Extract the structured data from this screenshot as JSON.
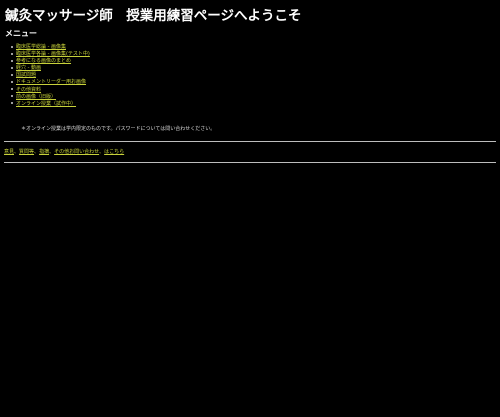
{
  "page": {
    "title": "鍼灸マッサージ師　授業用練習ページへようこそ"
  },
  "menu": {
    "heading": "メニュー",
    "items": [
      {
        "label": "臨床医学総論 - 画像集"
      },
      {
        "label": "臨床医学各論 - 画像集(テスト中)"
      },
      {
        "label": "参考になる画像のまとめ"
      },
      {
        "label": "経穴 - 動画"
      },
      {
        "label": "国試問題"
      },
      {
        "label": "ドキュメントリーダー用お画像"
      },
      {
        "label": "その他資料"
      },
      {
        "label": "前の画像（旧版）"
      },
      {
        "label": "オンライン授業（試作中）"
      }
    ]
  },
  "notice": "＊オンライン授業は学内限定のものです。パスワードについては問い合わせください。",
  "footer": {
    "links": [
      {
        "label": "意見"
      },
      {
        "label": "質問等"
      },
      {
        "label": "指摘"
      },
      {
        "label": "その他お問い合わせ"
      },
      {
        "label": "はこちら"
      }
    ],
    "separators": [
      "、",
      "、",
      "、",
      "、"
    ]
  },
  "colors": {
    "background": "#000000",
    "text": "#e8e8e8",
    "link": "#c8d23a",
    "rule": "#bdbdbd"
  }
}
